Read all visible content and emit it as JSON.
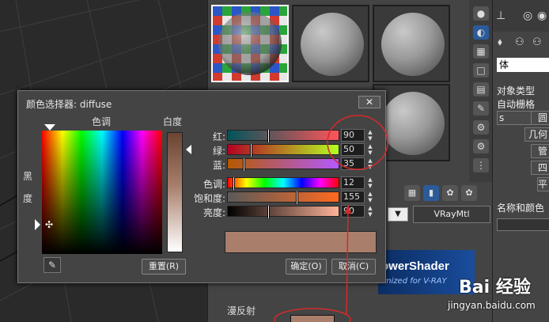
{
  "dialog": {
    "title": "颜色选择器: diffuse",
    "close_label": "✕",
    "hue_label": "色调",
    "whiteness_label": "白度",
    "blackness_label": "黑度",
    "sliders": [
      {
        "label": "红:",
        "value": "90"
      },
      {
        "label": "绿:",
        "value": "50"
      },
      {
        "label": "蓝:",
        "value": "35"
      },
      {
        "label": "色调:",
        "value": "12"
      },
      {
        "label": "饱和度:",
        "value": "155"
      },
      {
        "label": "亮度:",
        "value": "90"
      }
    ],
    "reset_button": "重置(R)",
    "ok_button": "确定(O)",
    "cancel_button": "取消(C)",
    "preview_color": "#a97f6c"
  },
  "material_editor": {
    "material_type": "VRayMtl",
    "banner_title": "owerShader",
    "banner_subtitle": "imized for V-RAY",
    "diffuse_label": "漫反射"
  },
  "command_panel": {
    "field_value": "体",
    "object_type_label": "对象类型",
    "auto_grid_label": "自动栅格",
    "buttons": [
      "s",
      "圆",
      "几何",
      "管",
      "四",
      "平"
    ],
    "name_color_label": "名称和颜色"
  },
  "watermark": {
    "logo_text": "Bai 经验",
    "site_text": "jingyan.baidu.com"
  }
}
